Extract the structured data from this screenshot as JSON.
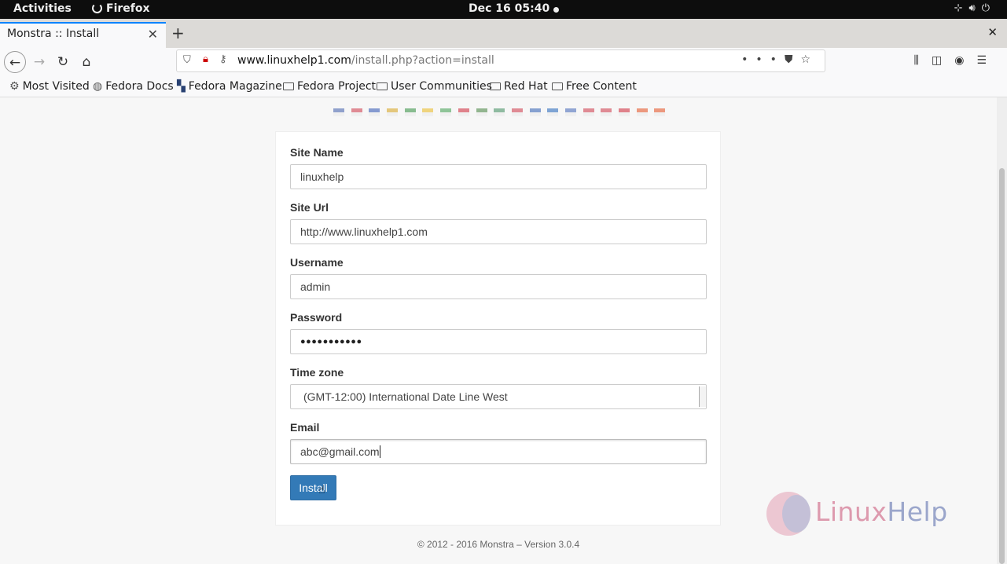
{
  "system_bar": {
    "activities": "Activities",
    "app_name": "Firefox",
    "clock": "Dec 16  05:40"
  },
  "browser": {
    "tab_title": "Monstra :: Install",
    "url_host": "www.linuxhelp1.com",
    "url_path": "/install.php?action=install",
    "bookmarks": [
      "Most Visited",
      "Fedora Docs",
      "Fedora Magazine",
      "Fedora Project",
      "User Communities",
      "Red Hat",
      "Free Content"
    ]
  },
  "form": {
    "site_name_label": "Site Name",
    "site_name_value": "linuxhelp",
    "site_url_label": "Site Url",
    "site_url_value": "http://www.linuxhelp1.com",
    "username_label": "Username",
    "username_value": "admin",
    "password_label": "Password",
    "password_value": "●●●●●●●●●●●",
    "timezone_label": "Time zone",
    "timezone_value": "(GMT-12:00) International Date Line West",
    "email_label": "Email",
    "email_value": "abc@gmail.com",
    "install_label": "Install"
  },
  "footer": "© 2012 - 2016 Monstra – Version 3.0.4",
  "watermark": {
    "left": "Linux",
    "right": "Help"
  },
  "colors": {
    "accent": "#337ab7",
    "tab_highlight": "#0a84ff",
    "flags": [
      "#3c5aa8",
      "#cc3344",
      "#2a4fb0",
      "#d4a017",
      "#2e8b3a",
      "#e8b81a",
      "#3a9a4a",
      "#cc2233",
      "#3f7f3a",
      "#3a8a5a",
      "#cc3344",
      "#2a5ab0",
      "#1c5fb8",
      "#3d62b5",
      "#cc3344",
      "#cc3344",
      "#cc2233",
      "#e34a1a",
      "#e34a1a"
    ]
  }
}
